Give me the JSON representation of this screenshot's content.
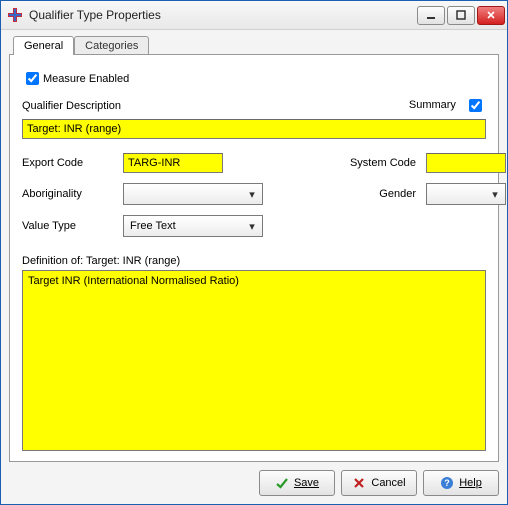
{
  "window": {
    "title": "Qualifier Type Properties"
  },
  "tabs": {
    "general": "General",
    "categories": "Categories"
  },
  "general": {
    "measure_enabled_label": "Measure Enabled",
    "measure_enabled_checked": true,
    "qualifier_description_label": "Qualifier Description",
    "summary_label": "Summary",
    "summary_checked": true,
    "qualifier_description_value": "Target: INR (range)",
    "export_code_label": "Export Code",
    "export_code_value": "TARG-INR",
    "system_code_label": "System Code",
    "system_code_value": "",
    "aboriginality_label": "Aboriginality",
    "aboriginality_value": "",
    "gender_label": "Gender",
    "gender_value": "",
    "value_type_label": "Value Type",
    "value_type_value": "Free Text",
    "definition_label": "Definition of: Target: INR (range)",
    "definition_value": "Target INR (International Normalised Ratio)"
  },
  "buttons": {
    "save": "Save",
    "cancel": "Cancel",
    "help": "Help"
  }
}
